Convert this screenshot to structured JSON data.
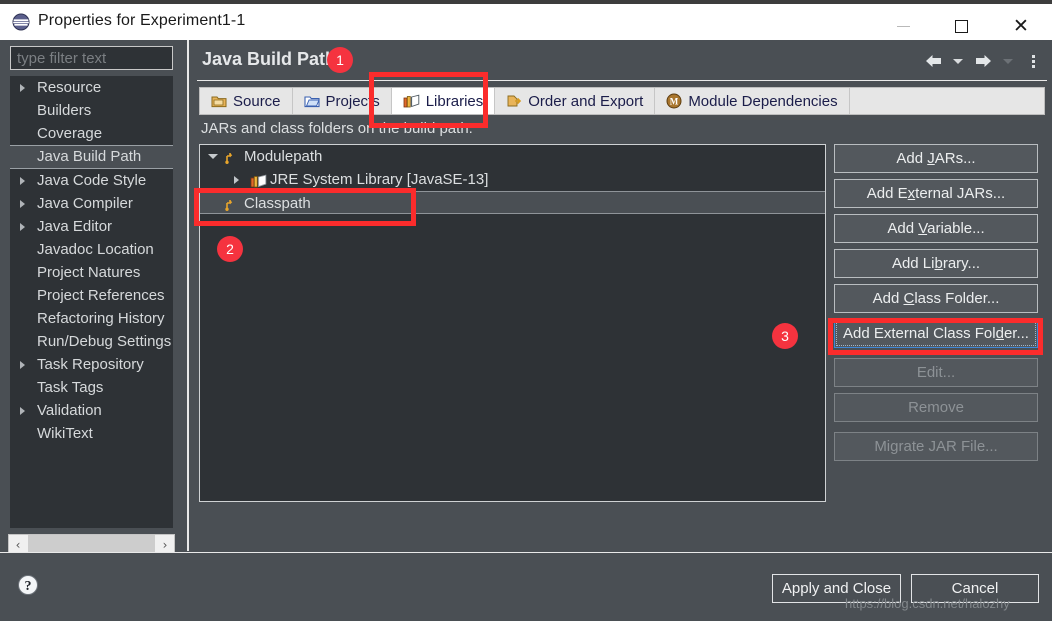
{
  "window": {
    "title": "Properties for Experiment1-1",
    "icon": "eclipse-logo-icon",
    "minimize": "–",
    "maximize": "□",
    "close": "✕"
  },
  "sidebar": {
    "filter_placeholder": "type filter text",
    "items": [
      {
        "label": "Resource",
        "expandable": true,
        "selected": false
      },
      {
        "label": "Builders",
        "expandable": false,
        "selected": false
      },
      {
        "label": "Coverage",
        "expandable": false,
        "selected": false
      },
      {
        "label": "Java Build Path",
        "expandable": false,
        "selected": true
      },
      {
        "label": "Java Code Style",
        "expandable": true,
        "selected": false
      },
      {
        "label": "Java Compiler",
        "expandable": true,
        "selected": false
      },
      {
        "label": "Java Editor",
        "expandable": true,
        "selected": false
      },
      {
        "label": "Javadoc Location",
        "expandable": false,
        "selected": false
      },
      {
        "label": "Project Natures",
        "expandable": false,
        "selected": false
      },
      {
        "label": "Project References",
        "expandable": false,
        "selected": false
      },
      {
        "label": "Refactoring History",
        "expandable": false,
        "selected": false
      },
      {
        "label": "Run/Debug Settings",
        "expandable": false,
        "selected": false
      },
      {
        "label": "Task Repository",
        "expandable": true,
        "selected": false
      },
      {
        "label": "Task Tags",
        "expandable": false,
        "selected": false
      },
      {
        "label": "Validation",
        "expandable": true,
        "selected": false
      },
      {
        "label": "WikiText",
        "expandable": false,
        "selected": false
      }
    ],
    "scroll_left": "‹",
    "scroll_right": "›"
  },
  "page": {
    "title": "Java Build Path",
    "nav": {
      "back": "back-arrow",
      "forward": "forward-arrow",
      "menu": "vertical-dots"
    }
  },
  "tabs": [
    {
      "label": "Source",
      "icon": "source-folder-icon",
      "active": false
    },
    {
      "label": "Projects",
      "icon": "projects-folder-icon",
      "active": false
    },
    {
      "label": "Libraries",
      "icon": "libraries-books-icon",
      "active": true
    },
    {
      "label": "Order and Export",
      "icon": "order-export-icon",
      "active": false
    },
    {
      "label": "Module Dependencies",
      "icon": "module-icon",
      "active": false
    }
  ],
  "main": {
    "section_label": "JARs and class folders on the build path:",
    "tree": [
      {
        "label": "Modulepath",
        "icon": "modulepath-icon",
        "indent": 0,
        "expander": "down",
        "selected": false
      },
      {
        "label": "JRE System Library [JavaSE-13]",
        "icon": "library-icon",
        "indent": 1,
        "expander": "right",
        "selected": false
      },
      {
        "label": "Classpath",
        "icon": "classpath-icon",
        "indent": 0,
        "expander": "none",
        "selected": true
      }
    ]
  },
  "buttons": {
    "side": [
      {
        "pre": "Add ",
        "mnemonic": "J",
        "post": "ARs...",
        "state": "normal"
      },
      {
        "pre": "Add E",
        "mnemonic": "x",
        "post": "ternal JARs...",
        "state": "normal"
      },
      {
        "pre": "Add ",
        "mnemonic": "V",
        "post": "ariable...",
        "state": "normal"
      },
      {
        "pre": "Add Li",
        "mnemonic": "b",
        "post": "rary...",
        "state": "normal"
      },
      {
        "pre": "Add ",
        "mnemonic": "C",
        "post": "lass Folder...",
        "state": "normal"
      },
      {
        "pre": "Add External Class Fol",
        "mnemonic": "d",
        "post": "er...",
        "state": "focused"
      },
      {
        "pre": "Edit...",
        "mnemonic": "",
        "post": "",
        "state": "disabled"
      },
      {
        "pre": "Remove",
        "mnemonic": "",
        "post": "",
        "state": "disabled"
      },
      {
        "pre": "Migrate JAR File...",
        "mnemonic": "",
        "post": "",
        "state": "disabled"
      }
    ],
    "apply": {
      "pre": "A",
      "mnemonic": "p",
      "post": "ply"
    },
    "apply_and_close": "Apply and Close",
    "cancel": "Cancel",
    "help": "help-icon"
  },
  "annotations": {
    "badge1": "1",
    "badge2": "2",
    "badge3": "3",
    "highlight_color": "#fb2c2c"
  },
  "watermark": "https://blog.csdn.net/halozhy"
}
